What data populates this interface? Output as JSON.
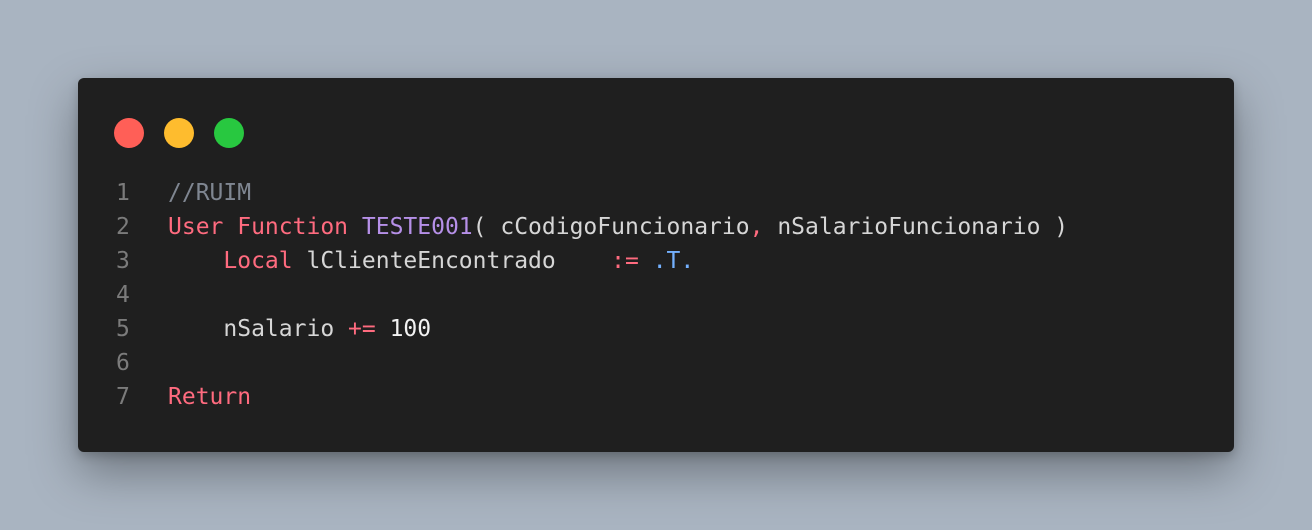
{
  "window": {
    "controls": {
      "close_color": "#ff5f57",
      "minimize_color": "#febc2e",
      "maximize_color": "#28c840"
    }
  },
  "colors": {
    "background": "#a9b4c1",
    "editor_background": "#1f1f1f",
    "line_number": "#7b7b7b",
    "comment": "#7f8691",
    "keyword": "#ff6b7f",
    "function_name": "#b690e8",
    "identifier": "#d6d6d6",
    "operator": "#ff6b7f",
    "constant": "#74b1ff",
    "number": "#f2f2f2"
  },
  "code": {
    "lines": [
      {
        "number": "1",
        "tokens": [
          {
            "text": "//RUIM",
            "color": "#7f8691"
          }
        ]
      },
      {
        "number": "2",
        "tokens": [
          {
            "text": "User Function ",
            "color": "#ff6b7f"
          },
          {
            "text": "TESTE001",
            "color": "#b690e8"
          },
          {
            "text": "( cCodigoFuncionario",
            "color": "#d6d6d6"
          },
          {
            "text": ",",
            "color": "#ff6b7f"
          },
          {
            "text": " nSalarioFuncionario )",
            "color": "#d6d6d6"
          }
        ]
      },
      {
        "number": "3",
        "tokens": [
          {
            "text": "    ",
            "color": "#d6d6d6"
          },
          {
            "text": "Local",
            "color": "#ff6b7f"
          },
          {
            "text": " lClienteEncontrado    ",
            "color": "#d6d6d6"
          },
          {
            "text": ":=",
            "color": "#ff6b7f"
          },
          {
            "text": " ",
            "color": "#d6d6d6"
          },
          {
            "text": ".T.",
            "color": "#74b1ff"
          }
        ]
      },
      {
        "number": "4",
        "tokens": []
      },
      {
        "number": "5",
        "tokens": [
          {
            "text": "    nSalario ",
            "color": "#d6d6d6"
          },
          {
            "text": "+=",
            "color": "#ff6b7f"
          },
          {
            "text": " ",
            "color": "#d6d6d6"
          },
          {
            "text": "100",
            "color": "#f2f2f2"
          }
        ]
      },
      {
        "number": "6",
        "tokens": []
      },
      {
        "number": "7",
        "tokens": [
          {
            "text": "Return",
            "color": "#ff6b7f"
          }
        ]
      }
    ]
  }
}
